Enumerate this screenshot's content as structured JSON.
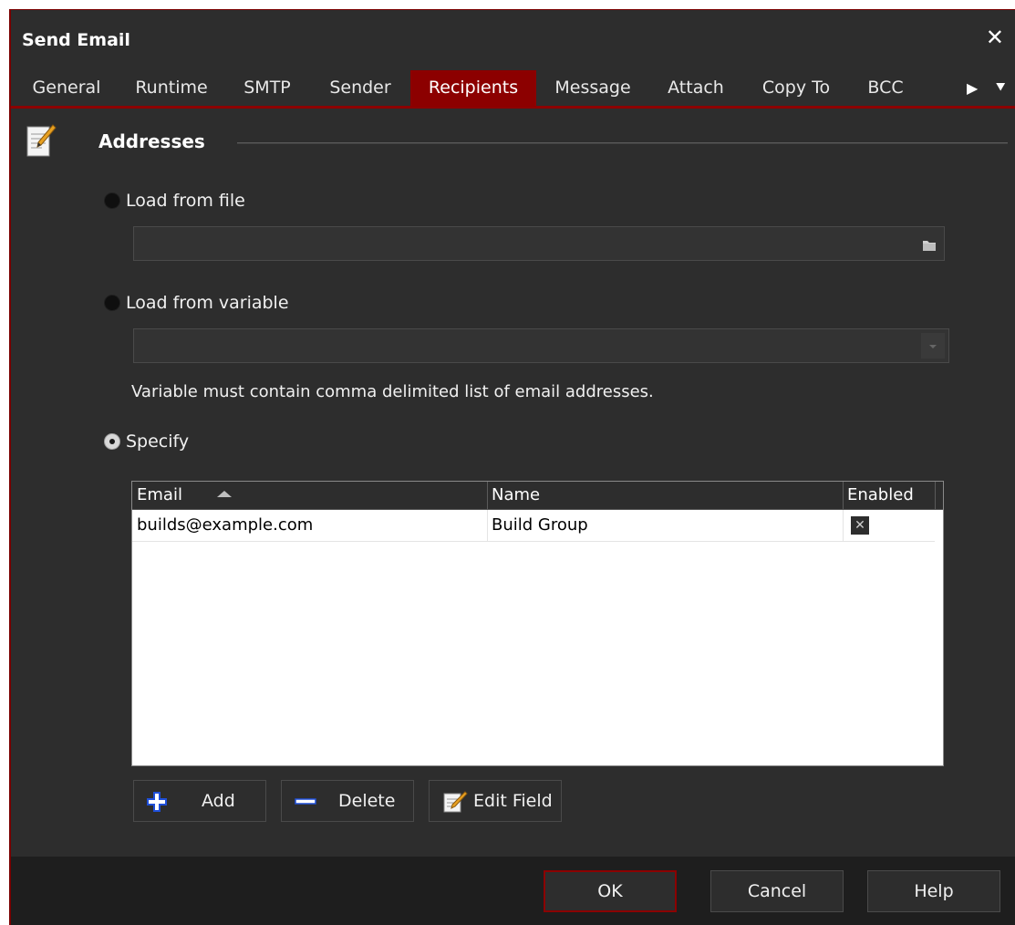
{
  "window": {
    "title": "Send Email",
    "close_icon": "close-icon"
  },
  "tabs": [
    {
      "label": "General"
    },
    {
      "label": "Runtime"
    },
    {
      "label": "SMTP"
    },
    {
      "label": "Sender"
    },
    {
      "label": "Recipients",
      "active": true
    },
    {
      "label": "Message"
    },
    {
      "label": "Attach"
    },
    {
      "label": "Copy To"
    },
    {
      "label": "BCC"
    }
  ],
  "section": {
    "title": "Addresses",
    "icon": "notepad-icon"
  },
  "load_from_file": {
    "label": "Load from file",
    "selected": false,
    "value": "",
    "browse_icon": "folder-icon"
  },
  "load_from_variable": {
    "label": "Load from variable",
    "selected": false,
    "value": "",
    "hint": "Variable must contain comma delimited list of email addresses."
  },
  "specify": {
    "label": "Specify",
    "selected": true
  },
  "grid": {
    "columns": [
      "Email",
      "Name",
      "Enabled"
    ],
    "sorted_column": "Email",
    "rows": [
      {
        "email": "builds@example.com",
        "name": "Build Group",
        "enabled": true
      }
    ]
  },
  "actions": {
    "add_label": "Add",
    "delete_label": "Delete",
    "edit_label": "Edit Field"
  },
  "footer": {
    "ok_label": "OK",
    "cancel_label": "Cancel",
    "help_label": "Help"
  },
  "colors": {
    "accent": "#8c0000",
    "background": "#2d2d2d",
    "footer": "#1e1e1e"
  }
}
